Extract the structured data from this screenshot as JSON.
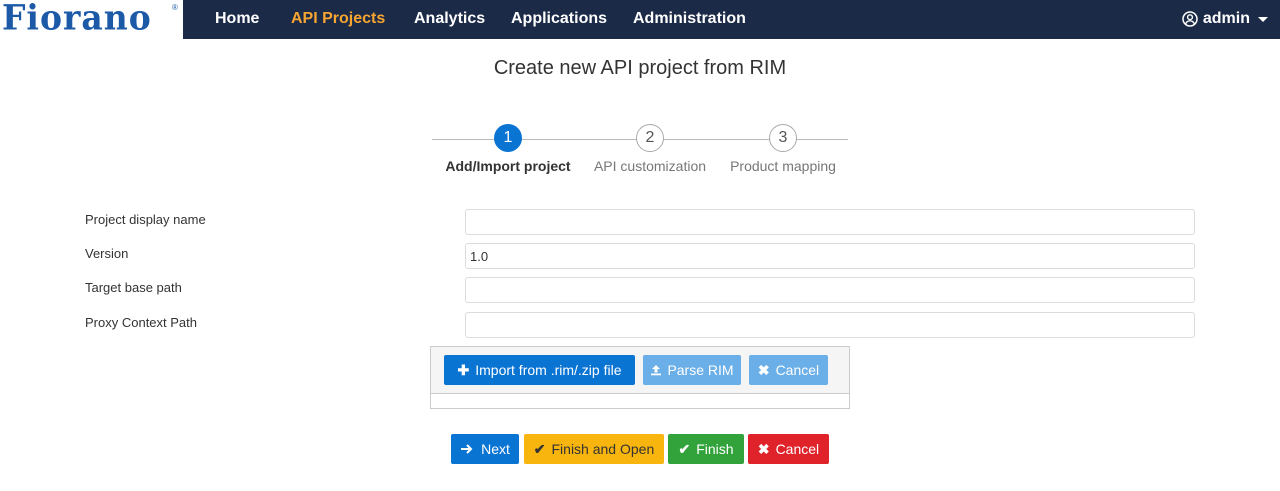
{
  "brand": {
    "logo_text": "Fiorano",
    "reg_mark": "®"
  },
  "nav": {
    "items": [
      {
        "label": "Home",
        "active": false
      },
      {
        "label": "API Projects",
        "active": true
      },
      {
        "label": "Analytics",
        "active": false
      },
      {
        "label": "Applications",
        "active": false
      },
      {
        "label": "Administration",
        "active": false
      }
    ],
    "user": "admin"
  },
  "page": {
    "title": "Create new API project from RIM"
  },
  "stepper": {
    "steps": [
      {
        "number": "1",
        "label": "Add/Import project",
        "active": true
      },
      {
        "number": "2",
        "label": "API customization",
        "active": false
      },
      {
        "number": "3",
        "label": "Product mapping",
        "active": false
      }
    ]
  },
  "form": {
    "display_name": {
      "label": "Project display name",
      "value": ""
    },
    "version": {
      "label": "Version",
      "value": "1.0"
    },
    "target_base_path": {
      "label": "Target base path",
      "value": ""
    },
    "proxy_context_path": {
      "label": "Proxy Context Path",
      "value": ""
    }
  },
  "upload": {
    "import_label": "Import from .rim/.zip file",
    "parse_label": "Parse RIM",
    "cancel_label": "Cancel"
  },
  "actions": {
    "next_label": "Next",
    "finish_open_label": "Finish and Open",
    "finish_label": "Finish",
    "cancel_label": "Cancel"
  },
  "colors": {
    "navbar": "#1b2a47",
    "active_nav": "#f7a531",
    "primary": "#0a74d3",
    "warning": "#f8b50e",
    "success": "#31a33a",
    "danger": "#e0232b"
  }
}
